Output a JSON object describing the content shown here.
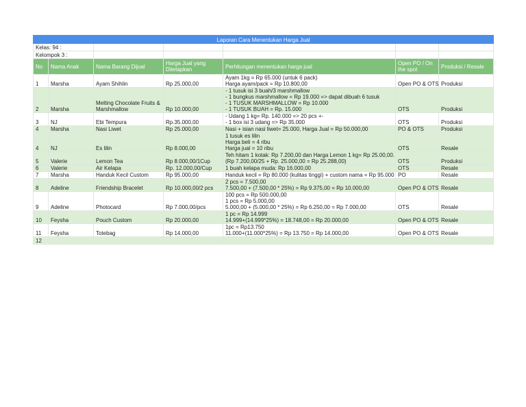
{
  "title": "Laporan Cara Menentukan Harga Jual",
  "kelas": "Kelas: 94 :",
  "kelompok": "Kelompok 3 :",
  "headers": [
    "No",
    "Nama Anak",
    "Nama Barang Dijual",
    "Harga Jual yang Ditetapkan",
    "Perhitungan menentukan harga jual",
    "Open PO / On the spot",
    "Produksi / Resale"
  ],
  "rows": [
    {
      "no": "1",
      "anak": "Marsha",
      "barang": "Ayam Shihlin",
      "harga": "Rp 25.000,00",
      "hitung": [
        "Ayam 1kg = Rp 65.000 (untuk 6 pack)",
        "Harga ayam/pack = Rp 10.800,00"
      ],
      "po": "Open PO & OTS",
      "prod": "Produksi"
    },
    {
      "no": "2",
      "anak": "Marsha",
      "barang": "Melting Chocolate Fruits & Marshmallow",
      "harga": "Rp 10.000,00",
      "hitung": [
        "- 1 tusuk isi 3 buah/3 marshmallow",
        "- 1 bungkus marshmallow = Rp 19.000 => dapat dibuah 6 tusuk",
        "- 1 TUSUK MARSHMALLOW = Rp 10.000",
        "- 1 TUSUK BUAH = Rp. 15.000"
      ],
      "po": "OTS",
      "prod": "Produksi"
    },
    {
      "no": "3",
      "anak": "NJ",
      "barang": "Ebi Tempura",
      "harga": "Rp.35.000,00",
      "hitung": [
        "- Udang 1 kg= Rp. 140.000 => 20 pcs +-",
        "- 1 box isi 3 udang => Rp 35.000"
      ],
      "po": "OTS",
      "prod": "Produksi"
    },
    {
      "no": "4",
      "anak": "Marsha",
      "barang": "Nasi Liwet",
      "harga": "Rp 25.000,00",
      "hitung": [
        "Nasi + isian nasi liwet= 25.000, Harga Jual = Rp 50.000,00"
      ],
      "po": "PO & OTS",
      "prod": "Produksi"
    },
    {
      "no": "4",
      "anak": "NJ",
      "barang": "Es lilin",
      "harga": "Rp 8.000,00",
      "hitung": [
        "1 tusuk es lilin",
        "Harga beli = 4 ribu",
        "Harga jual = 10 ribu"
      ],
      "po": "OTS",
      "prod": "Resale"
    },
    {
      "no": "5",
      "anak": "Valerie",
      "barang": "Lemon Tea",
      "harga": "Rp 8.000,00/1Cup",
      "hitung": [
        "Teh hitam 1 kotak: Rp 7.200,00 dan Harga Lemon 1 kg= Rp 25.00,00.",
        "(Rp 7.200,00/25 + Rp. 25.000,00 = Rp 25.288,00)"
      ],
      "po": "OTS",
      "prod": "Produksi"
    },
    {
      "no": "6",
      "anak": "Valerie",
      "barang": "Air Kelapa",
      "harga": "Rp. 12.000,00/Cup",
      "hitung": [
        "1 buah kelapa muda: Rp 16.000,00"
      ],
      "po": "OTS",
      "prod": "Resale"
    },
    {
      "no": "7",
      "anak": "Marsha",
      "barang": "Handuk Kecil Custom",
      "harga": "Rp 95.000,00",
      "hitung": [
        "Handuk kecil = Rp 80.000 (kulitas tinggi) + custom nama = Rp 95.000"
      ],
      "po": "PO",
      "prod": "Resale"
    },
    {
      "no": "8",
      "anak": "Adeline",
      "barang": "Friendship Bracelet",
      "harga": "Rp 10.000,00/2 pcs",
      "hitung": [
        "2 pcs = 7.500,00",
        "7.500,00 + (7.500,00 * 25%) = Rp 9.375,00 = Rp 10.000,00"
      ],
      "po": "Open PO & OTS",
      "prod": "Resale"
    },
    {
      "no": "9",
      "anak": "Adeline",
      "barang": "Photocard",
      "harga": "Rp 7.000,00/pcs",
      "hitung": [
        "100 pcs = Rp 500.000,00",
        "1 pcs = Rp 5.000,00",
        "5.000,00 + (5.000,00 * 25%) = Rp 6.250,00 = Rp 7.000,00"
      ],
      "po": "OTS",
      "prod": "Resale"
    },
    {
      "no": "10",
      "anak": "Feysha",
      "barang": "Pouch Custom",
      "harga": "Rp 20.000,00",
      "hitung": [
        "1 pc = Rp 14.999",
        "14.999+(14.999*25%) = 18.748,00 = Rp 20.000,00"
      ],
      "po": "Open PO & OTS",
      "prod": "Resale"
    },
    {
      "no": "11",
      "anak": "Feysha",
      "barang": "Totebag",
      "harga": "Rp 14.000,00",
      "hitung": [
        "1pc = Rp13.750",
        "11.000+(11.000*25%) = Rp 13.750 = Rp 14.000,00"
      ],
      "po": "Open PO & OTS",
      "prod": "Resale"
    },
    {
      "no": "12",
      "anak": "",
      "barang": "",
      "harga": "",
      "hitung": [],
      "po": "",
      "prod": ""
    }
  ]
}
